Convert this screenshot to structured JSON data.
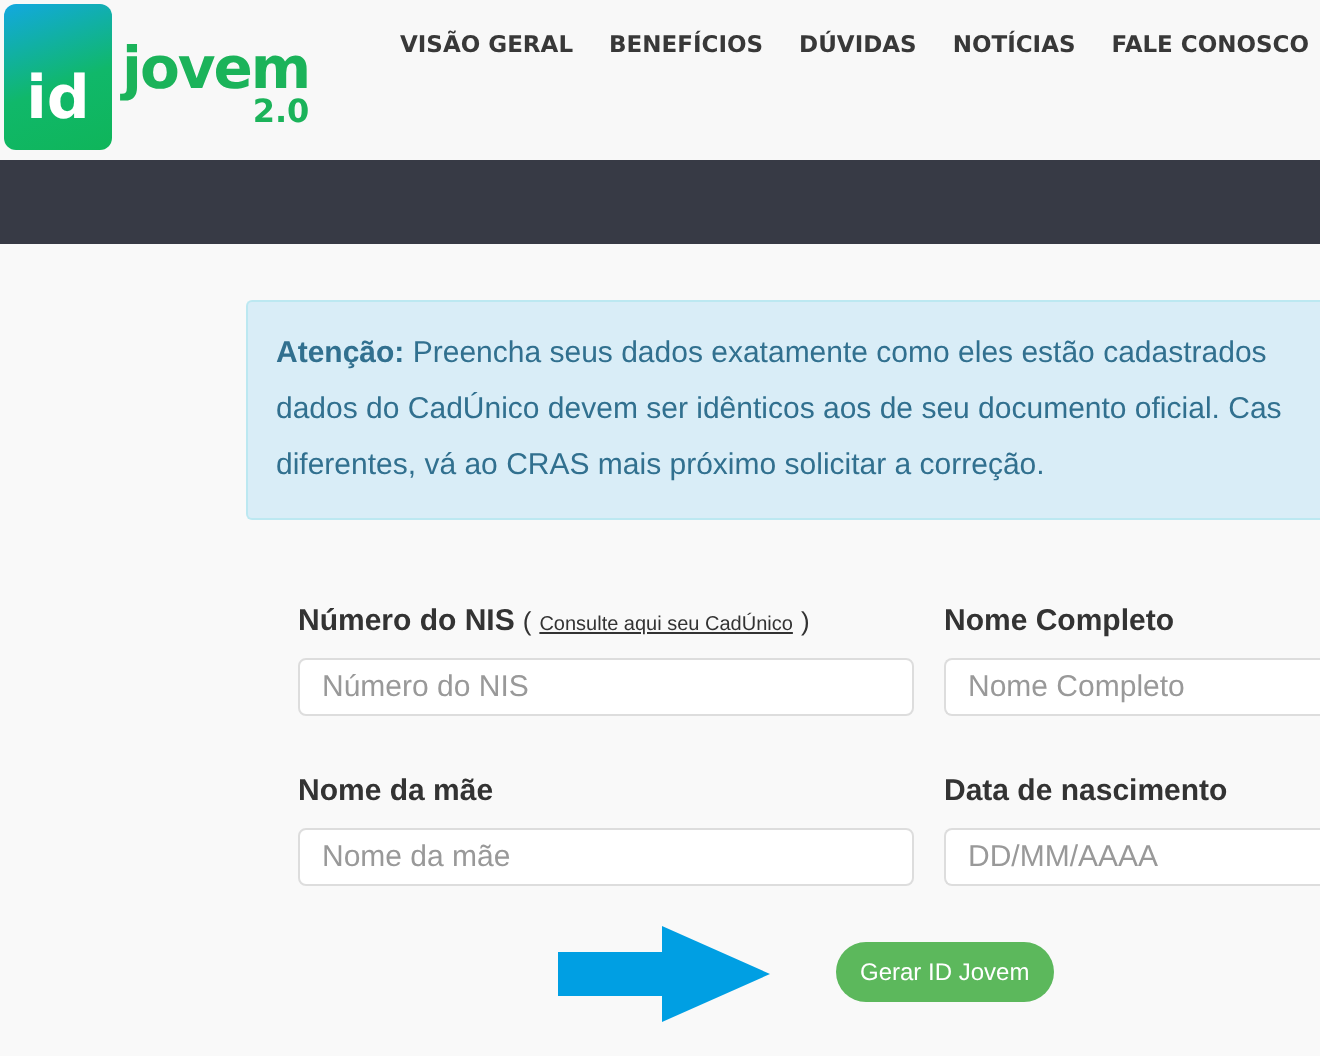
{
  "logo": {
    "mark": "id",
    "name": "jovem",
    "version": "2.0"
  },
  "nav": [
    {
      "label": "VISÃO GERAL"
    },
    {
      "label": "BENEFÍCIOS"
    },
    {
      "label": "DÚVIDAS"
    },
    {
      "label": "NOTÍCIAS"
    },
    {
      "label": "FALE CONOSCO"
    }
  ],
  "alert": {
    "lines": [
      "**Atenção:** Preencha seus dados exatamente como eles estão cadastrados",
      "dados do CadÚnico devem ser idênticos aos de seu documento oficial. Cas",
      "diferentes, vá ao CRAS mais próximo solicitar a correção."
    ]
  },
  "form": {
    "fields": [
      {
        "label": "Número do NIS",
        "paren_open": "(",
        "link": "Consulte aqui seu CadÚnico",
        "paren_close": ")",
        "placeholder": "Número do NIS"
      },
      {
        "label": "Nome Completo",
        "placeholder": "Nome Completo"
      },
      {
        "label": "Nome da mãe",
        "placeholder": "Nome da mãe"
      },
      {
        "label": "Data de nascimento",
        "placeholder": "DD/MM/AAAA"
      }
    ],
    "submit": "Gerar ID Jovem"
  }
}
